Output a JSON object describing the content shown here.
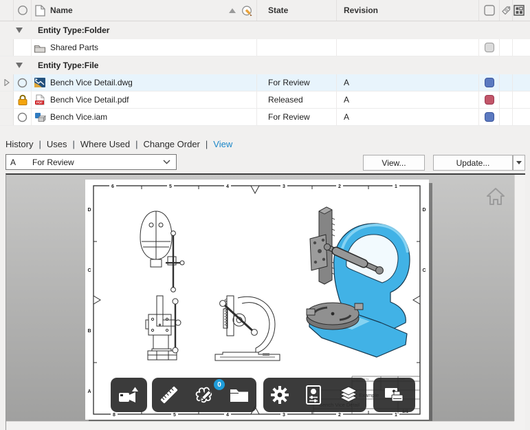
{
  "table": {
    "columns": {
      "name": "Name",
      "state": "State",
      "revision": "Revision"
    },
    "groups": [
      {
        "label": "Entity Type:Folder"
      },
      {
        "label": "Entity Type:File"
      }
    ],
    "rows": {
      "shared": {
        "name": "Shared Parts"
      },
      "dwg": {
        "name": "Bench Vice Detail.dwg",
        "state": "For Review",
        "revision": "A"
      },
      "pdf": {
        "name": "Bench Vice Detail.pdf",
        "state": "Released",
        "revision": "A",
        "file_badge": "PDF"
      },
      "iam": {
        "name": "Bench Vice.iam",
        "state": "For Review",
        "revision": "A"
      }
    }
  },
  "tabs": {
    "history": "History",
    "uses": "Uses",
    "where_used": "Where Used",
    "change_order": "Change Order",
    "view": "View"
  },
  "controls": {
    "revision": "A",
    "state": "For Review",
    "view_button": "View...",
    "update_button": "Update..."
  },
  "preview": {
    "markup_count": "0",
    "sheet": {
      "zones_top": [
        "6",
        "5",
        "4",
        "3",
        "2",
        "1"
      ],
      "zones_bottom": [
        "8",
        "5",
        "4",
        "3",
        "2",
        "1"
      ],
      "rows_left": [
        "D",
        "C",
        "B",
        "A"
      ],
      "rows_right": [
        "D",
        "C"
      ],
      "titleblock": {
        "company": "Example",
        "title": "Bench Vice Detail",
        "sheet_num": "1/1",
        "approved": "Approved by",
        "date": "Date"
      }
    }
  },
  "colors": {
    "selection": "#e8f4fc",
    "active_tab": "#1a86c8",
    "badge_blue": "#5b79c0",
    "badge_red": "#c25669",
    "badge_neutral": "#dbdbdb",
    "lock_orange": "#f4a50e",
    "markup_badge": "#1e9cd9",
    "frame_blue": "#41b2e6"
  }
}
